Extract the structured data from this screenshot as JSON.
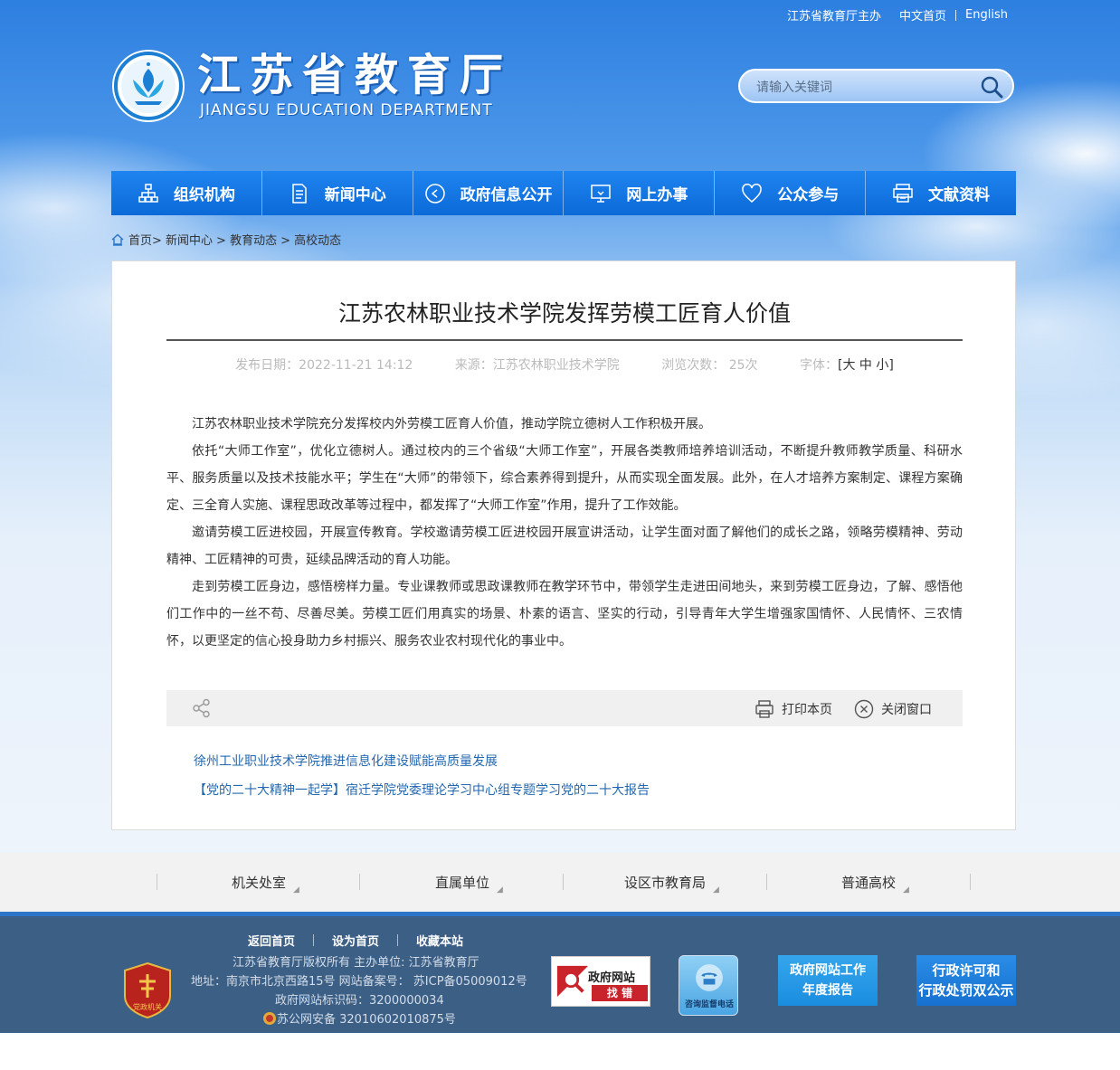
{
  "top_links": {
    "host": "江苏省教育厅主办",
    "chinese": "中文首页",
    "english": "English"
  },
  "site": {
    "name_cn": "江苏省教育厅",
    "name_en": "JIANGSU EDUCATION DEPARTMENT"
  },
  "search": {
    "placeholder": "请输入关键词"
  },
  "nav": [
    {
      "label": "组织机构",
      "icon": "org-chart-icon"
    },
    {
      "label": "新闻中心",
      "icon": "document-icon"
    },
    {
      "label": "政府信息公开",
      "icon": "play-circle-icon"
    },
    {
      "label": "网上办事",
      "icon": "monitor-icon"
    },
    {
      "label": "公众参与",
      "icon": "heart-icon"
    },
    {
      "label": "文献资料",
      "icon": "printer-stack-icon"
    }
  ],
  "breadcrumb": {
    "home": "首页",
    "l1": "> 新闻中心",
    "l2": "> 教育动态",
    "l3": "> 高校动态"
  },
  "article": {
    "title": "江苏农林职业技术学院发挥劳模工匠育人价值",
    "date": "发布日期：2022-11-21 14:12",
    "source": "来源：江苏农林职业技术学院",
    "views": "浏览次数： 25次",
    "font_label": "字体：",
    "font_sizes": "[大 中 小]",
    "paragraphs": [
      "江苏农林职业技术学院充分发挥校内外劳模工匠育人价值，推动学院立德树人工作积极开展。",
      "依托“大师工作室”，优化立德树人。通过校内的三个省级“大师工作室”，开展各类教师培养培训活动，不断提升教师教学质量、科研水平、服务质量以及技术技能水平；学生在“大师”的带领下，综合素养得到提升，从而实现全面发展。此外，在人才培养方案制定、课程方案确定、三全育人实施、课程思政改革等过程中，都发挥了“大师工作室”作用，提升了工作效能。",
      "邀请劳模工匠进校园，开展宣传教育。学校邀请劳模工匠进校园开展宣讲活动，让学生面对面了解他们的成长之路，领略劳模精神、劳动精神、工匠精神的可贵，延续品牌活动的育人功能。",
      "走到劳模工匠身边，感悟榜样力量。专业课教师或思政课教师在教学环节中，带领学生走进田间地头，来到劳模工匠身边，了解、感悟他们工作中的一丝不苟、尽善尽美。劳模工匠们用真实的场景、朴素的语言、坚实的行动，引导青年大学生增强家国情怀、人民情怀、三农情怀，以更坚定的信心投身助力乡村振兴、服务农业农村现代化的事业中。"
    ],
    "print_label": "打印本页",
    "close_label": "关闭窗口",
    "related": [
      "徐州工业职业技术学院推进信息化建设赋能高质量发展",
      "【党的二十大精神一起学】宿迁学院党委理论学习中心组专题学习党的二十大报告"
    ]
  },
  "tags": [
    "机关处室",
    "直属单位",
    "设区市教育局",
    "普通高校"
  ],
  "footer": {
    "links": [
      "返回首页",
      "设为首页",
      "收藏本站"
    ],
    "copyright": "江苏省教育厅版权所有 主办单位: 江苏省教育厅",
    "address": "地址：南京市北京西路15号 网站备案号： 苏ICP备05009012号",
    "site_id": "政府网站标识码：3200000034",
    "police": "苏公网安备 32010602010875号",
    "badge_text": "党政机关",
    "error_box": {
      "line1": "政府网站",
      "line2": "找 错"
    },
    "hotline": "咨询监督电话",
    "report": {
      "line1": "政府网站工作",
      "line2": "年度报告"
    },
    "permit": {
      "line1": "行政许可和",
      "line2": "行政处罚双公示"
    }
  },
  "colors": {
    "nav": "#1478e6",
    "footer": "#3c5f86",
    "link": "#2468b0"
  }
}
